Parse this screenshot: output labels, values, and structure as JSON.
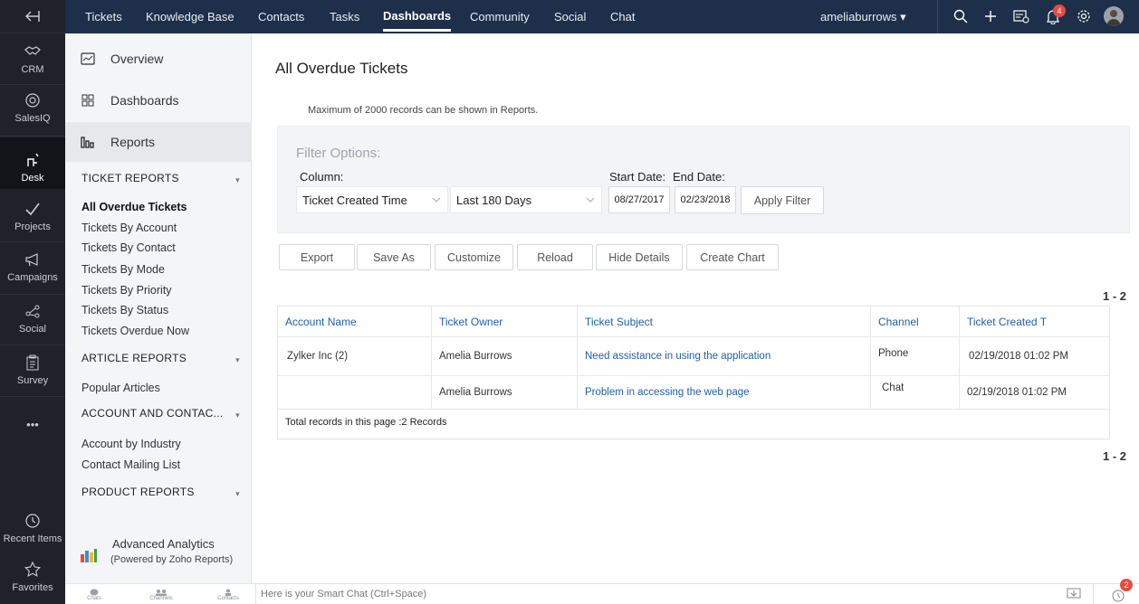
{
  "rail": {
    "items": [
      {
        "label": "CRM",
        "icon": "handshake-icon"
      },
      {
        "label": "SalesIQ",
        "icon": "target-icon"
      },
      {
        "label": "Desk",
        "icon": "desk-icon"
      },
      {
        "label": "Projects",
        "icon": "check-icon"
      },
      {
        "label": "Campaigns",
        "icon": "megaphone-icon"
      },
      {
        "label": "Social",
        "icon": "share-icon"
      },
      {
        "label": "Survey",
        "icon": "clipboard-icon"
      }
    ],
    "more": "•••",
    "recent": "Recent Items",
    "favorites": "Favorites"
  },
  "topnav": {
    "tabs": [
      "Tickets",
      "Knowledge Base",
      "Contacts",
      "Tasks",
      "Dashboards",
      "Community",
      "Social",
      "Chat"
    ],
    "active_tab": "Dashboards",
    "user": "ameliaburrows ▾",
    "notification_count": "4"
  },
  "sidebar": {
    "overview": "Overview",
    "dashboards": "Dashboards",
    "reports": "Reports",
    "sections": {
      "ticket_reports": "TICKET REPORTS",
      "article_reports": "ARTICLE REPORTS",
      "account_contact": "ACCOUNT AND CONTAC...",
      "product_reports": "PRODUCT REPORTS"
    },
    "ticket_links": [
      "All Overdue Tickets",
      "Tickets By Account",
      "Tickets By Contact",
      "Tickets By Mode",
      "Tickets By Priority",
      "Tickets By Status",
      "Tickets Overdue Now"
    ],
    "article_links": [
      "Popular Articles"
    ],
    "account_links": [
      "Account by Industry",
      "Contact Mailing List"
    ],
    "analytics_title": "Advanced Analytics",
    "analytics_sub": "(Powered by Zoho Reports)"
  },
  "main": {
    "title": "All Overdue Tickets",
    "note": "Maximum of 2000 records can be shown in Reports.",
    "filter": {
      "title": "Filter Options:",
      "column_label": "Column:",
      "column_value": "Ticket Created Time",
      "range_value": "Last 180 Days",
      "start_label": "Start Date:",
      "end_label": "End Date:",
      "start_date": "08/27/2017",
      "end_date": "02/23/2018",
      "apply": "Apply Filter"
    },
    "actions": [
      "Export",
      "Save As",
      "Customize",
      "Reload",
      "Hide Details",
      "Create Chart"
    ],
    "range": "1 - 2",
    "table": {
      "headers": [
        "Account Name",
        "Ticket Owner",
        "Ticket Subject",
        "Channel",
        "Ticket Created T"
      ],
      "rows": [
        [
          "Zylker Inc (2)",
          "Amelia Burrows",
          "Need assistance in using the application",
          "Phone",
          "02/19/2018 01:02 PM"
        ],
        [
          "",
          "Amelia Burrows",
          "Problem in accessing the web page",
          "Chat",
          "02/19/2018 01:02 PM"
        ]
      ],
      "footer": "Total records in this page :2 Records"
    }
  },
  "bottombar": {
    "tabs": [
      "Chats",
      "Channels",
      "Contacts"
    ],
    "smart_chat": "Here is your Smart Chat (Ctrl+Space)",
    "alarm_count": "2"
  },
  "colors": {
    "nav_bg": "#1e2f4a",
    "rail_bg": "#1f2329",
    "link": "#1f5fae",
    "badge": "#e84b3c"
  }
}
